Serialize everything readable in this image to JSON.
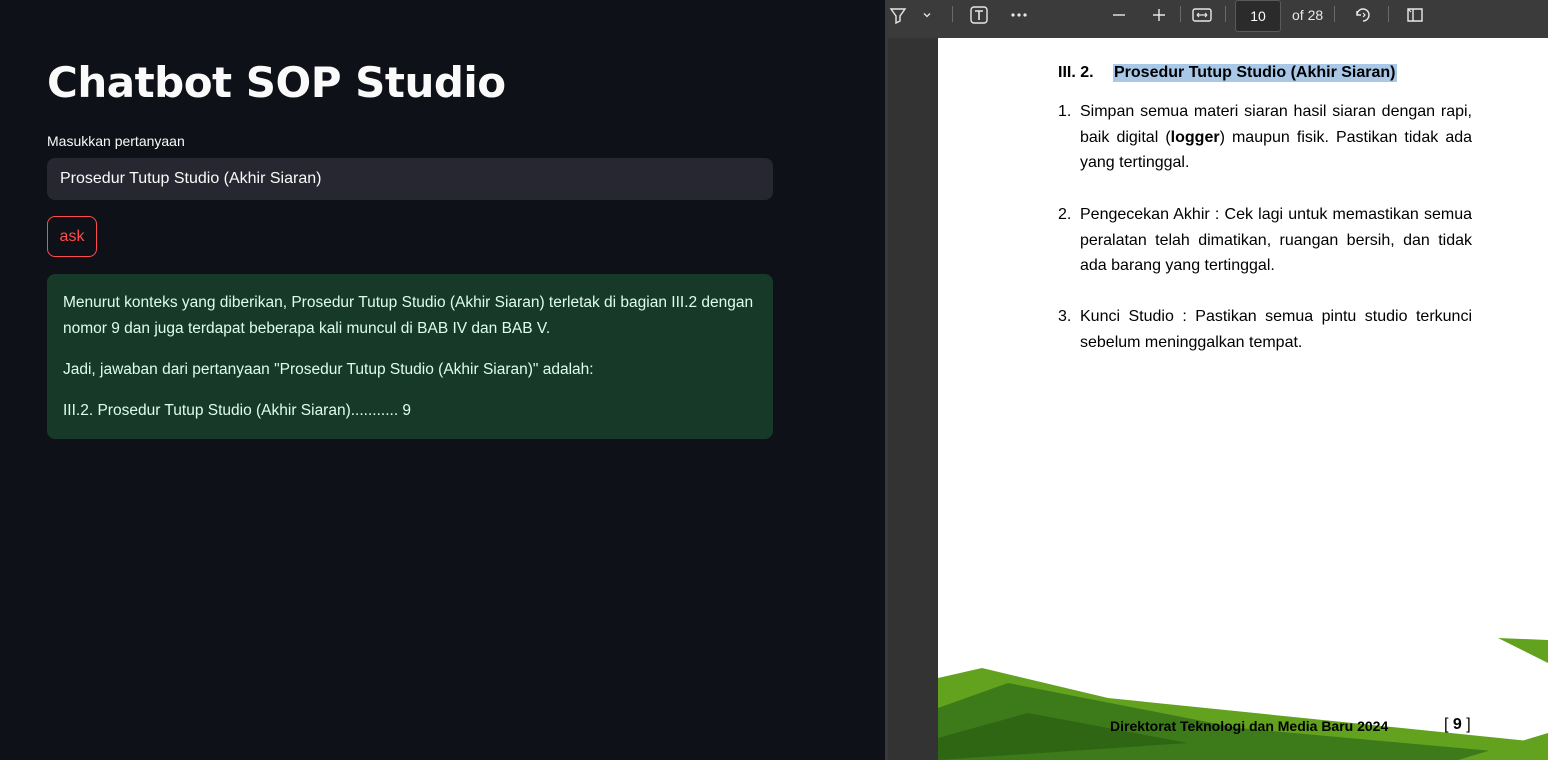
{
  "app": {
    "title": "Chatbot SOP Studio",
    "input_label": "Masukkan pertanyaan",
    "input_value": "Prosedur Tutup Studio (Akhir Siaran)",
    "ask_label": "ask",
    "answer": [
      "Menurut konteks yang diberikan, Prosedur Tutup Studio (Akhir Siaran) terletak di bagian III.2 dengan nomor 9 dan juga terdapat beberapa kali muncul di BAB IV dan BAB V.",
      "Jadi, jawaban dari pertanyaan \"Prosedur Tutup Studio (Akhir Siaran)\" adalah:",
      "III.2. Prosedur Tutup Studio (Akhir Siaran)........... 9"
    ]
  },
  "viewer": {
    "toolbar": {
      "current_page": "10",
      "of_pages": "of 28",
      "icons": [
        "highlight-icon",
        "chevron-down-icon",
        "text-box-icon",
        "more-icon",
        "zoom-out-icon",
        "zoom-in-icon",
        "fit-width-icon",
        "rotate-icon",
        "page-view-icon"
      ]
    },
    "page": {
      "section_number": "III. 2.",
      "section_title": "Prosedur Tutup Studio (Akhir Siaran)",
      "items": [
        {
          "n": "1.",
          "pre": "Simpan semua materi siaran hasil siaran dengan rapi, baik digital (",
          "bold": "logger",
          "post": ") maupun fisik. Pastikan tidak ada yang tertinggal."
        },
        {
          "n": "2.",
          "pre": "Pengecekan Akhir : Cek lagi untuk memastikan semua peralatan telah dimatikan, ruangan bersih, dan tidak ada barang yang tertinggal.",
          "bold": "",
          "post": ""
        },
        {
          "n": "3.",
          "pre": "Kunci Studio : Pastikan semua pintu studio terkunci sebelum meninggalkan tempat.",
          "bold": "",
          "post": ""
        }
      ],
      "footer_text": "Direktorat Teknologi dan Media Baru 2024",
      "footer_page_open": "[",
      "footer_page": "9",
      "footer_page_close": "]"
    },
    "colors": {
      "highlight": "#a9c8e8",
      "green_dark": "#3d7a1a",
      "green_light": "#62a21e"
    }
  }
}
